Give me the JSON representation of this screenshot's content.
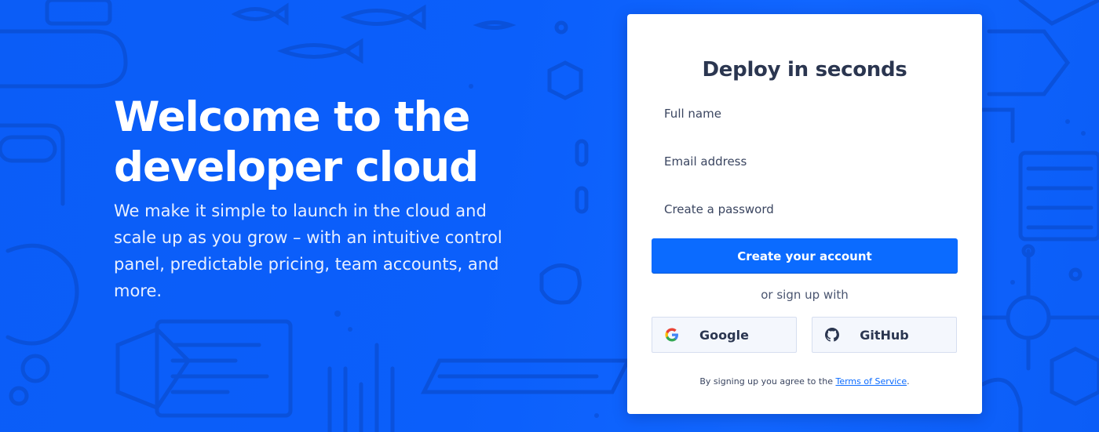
{
  "hero": {
    "title_line1": "Welcome to the",
    "title_line2": "developer cloud",
    "subtitle": "We make it simple to launch in the cloud and scale up as you grow – with an intuitive control panel, predictable pricing, team accounts, and more."
  },
  "signup": {
    "title": "Deploy in seconds",
    "full_name_placeholder": "Full name",
    "email_placeholder": "Email address",
    "password_placeholder": "Create a password",
    "submit_label": "Create your account",
    "or_text": "or sign up with",
    "google_label": "Google",
    "github_label": "GitHub",
    "legal_prefix": "By signing up you agree to the ",
    "terms_link": "Terms of Service",
    "legal_suffix": "."
  },
  "colors": {
    "background": "#0b5df7",
    "primary_button": "#0b6bff",
    "card": "#ffffff",
    "heading_text": "#2b3650"
  },
  "icons": {
    "google": "google-icon",
    "github": "github-icon"
  }
}
